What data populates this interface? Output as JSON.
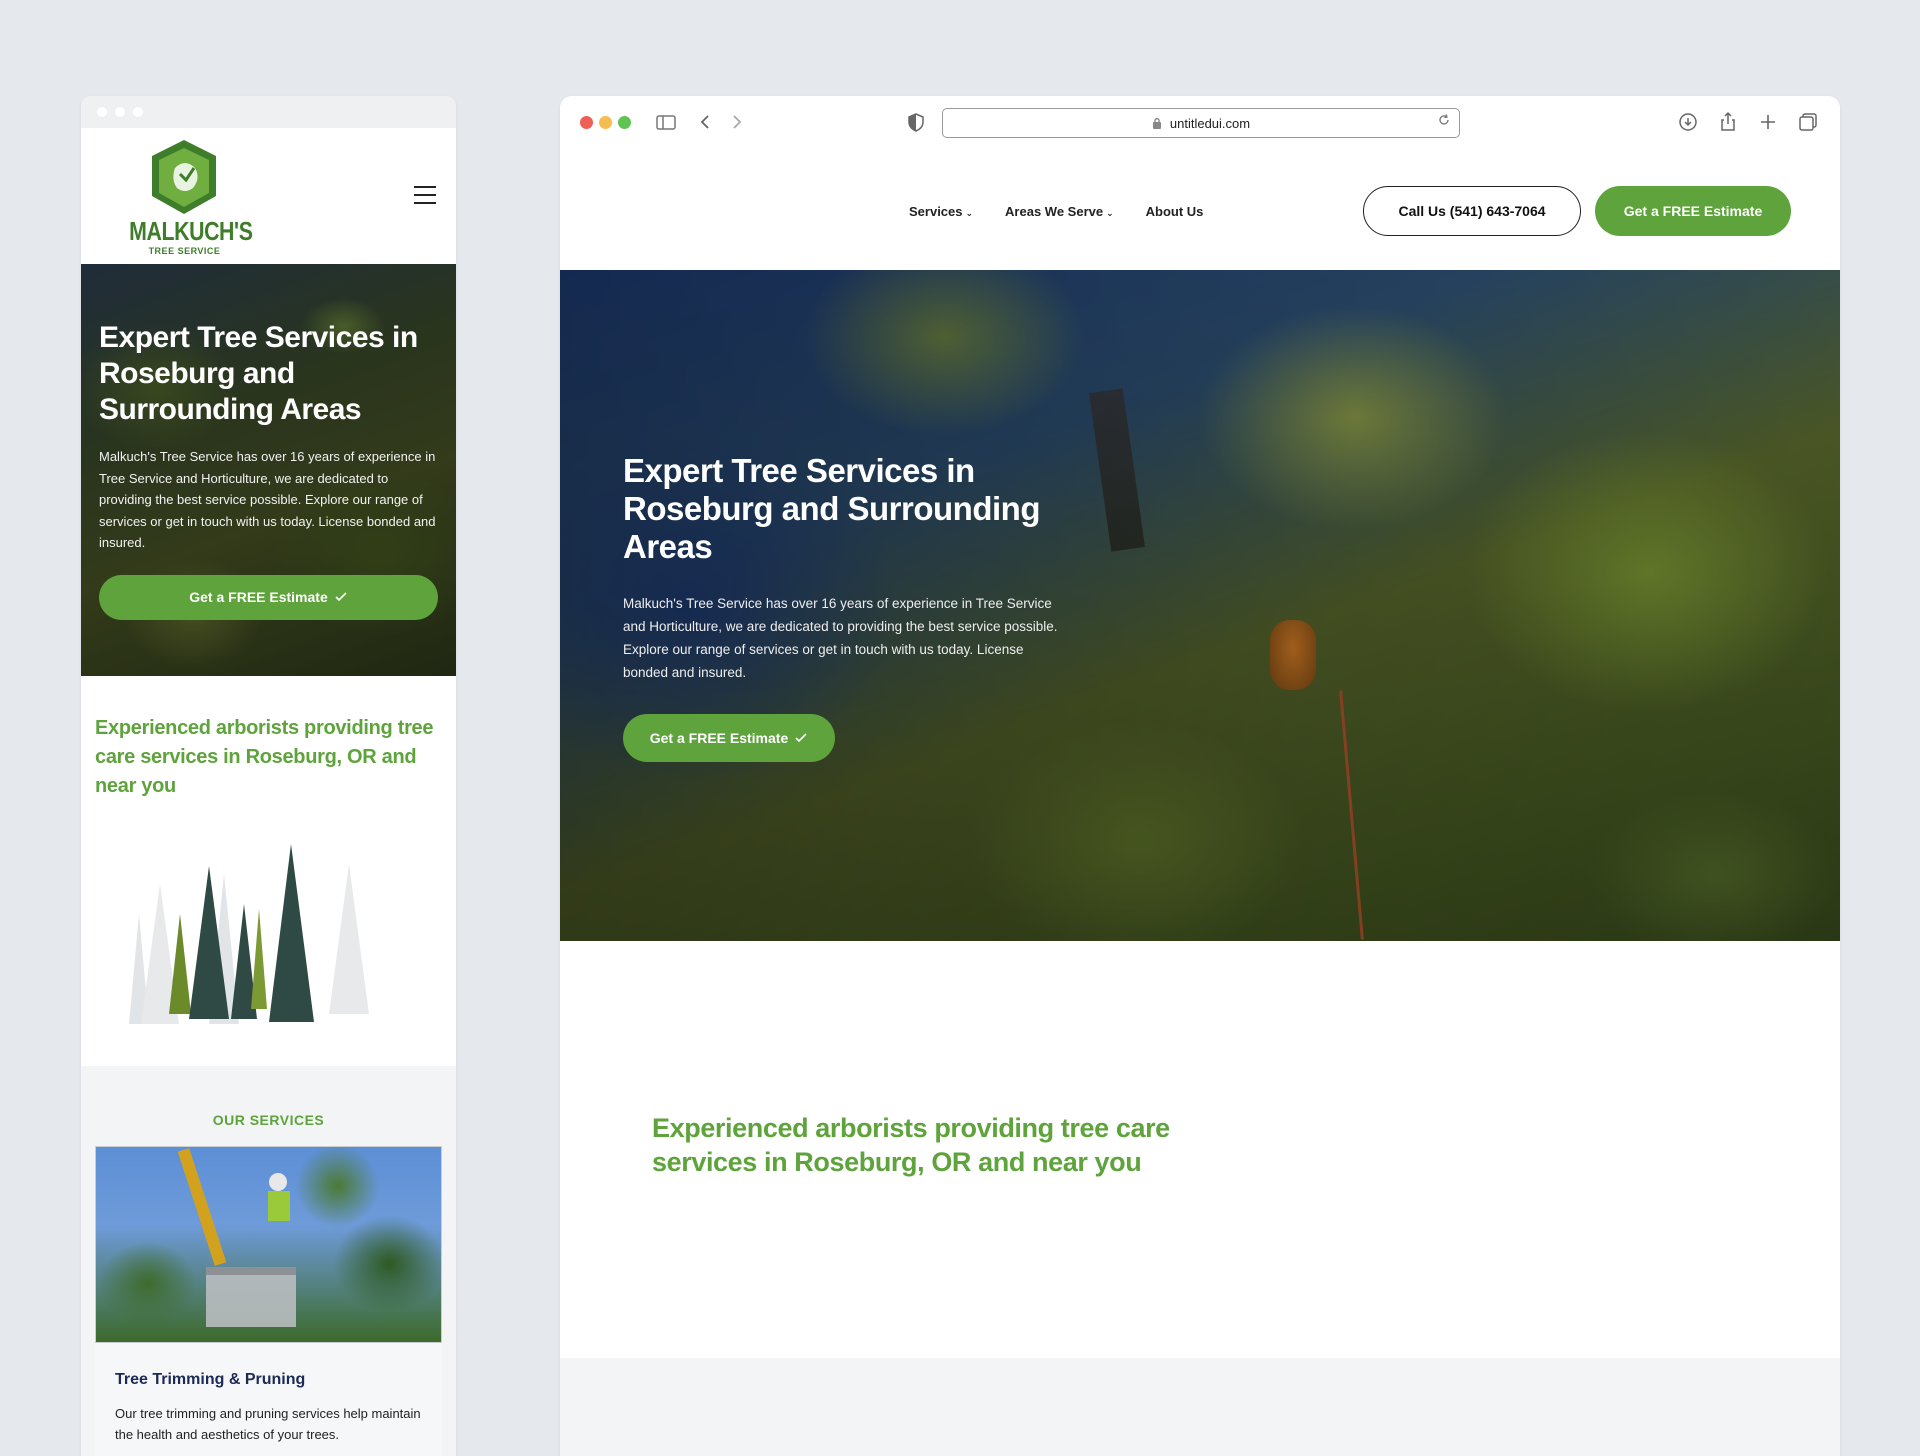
{
  "mobile": {
    "logo": {
      "name": "MALKUCH'S",
      "tagline": "TREE SERVICE"
    },
    "hero": {
      "title": "Expert Tree Services in Roseburg and Surrounding Areas",
      "body": "Malkuch's Tree Service has over 16 years of experience in Tree Service and Horticulture, we are dedicated to providing the best service possible. Explore our range of services or get in touch with us today. License bonded and insured.",
      "cta": "Get a FREE Estimate"
    },
    "intro": {
      "headline": "Experienced arborists providing tree care services in Roseburg, OR and near you"
    },
    "services": {
      "eyebrow": "OUR SERVICES",
      "card": {
        "title": "Tree Trimming & Pruning",
        "body": "Our tree trimming and pruning services help maintain the health and aesthetics of your trees."
      }
    }
  },
  "desktop": {
    "browser": {
      "url": "untitledui.com"
    },
    "nav": {
      "items": [
        {
          "label": "Services",
          "has_dropdown": true
        },
        {
          "label": "Areas We Serve",
          "has_dropdown": true
        },
        {
          "label": "About Us",
          "has_dropdown": false
        }
      ],
      "call_button": "Call Us (541) 643-7064",
      "estimate_button": "Get a FREE Estimate"
    },
    "hero": {
      "title": "Expert Tree Services in Roseburg and Surrounding Areas",
      "body": "Malkuch's Tree Service has over 16 years of experience in Tree Service and Horticulture, we are dedicated to providing the best service possible. Explore our range of services or get in touch with us today. License bonded and insured.",
      "cta": "Get a FREE Estimate"
    },
    "intro": {
      "headline": "Experienced arborists providing tree care services in Roseburg, OR and near you"
    }
  },
  "icons": {
    "check": "check-icon",
    "chevron": "chevron-down-icon",
    "lock": "lock-icon",
    "reload": "reload-icon",
    "menu": "hamburger-menu-icon"
  },
  "colors": {
    "brand_green": "#5ea33b",
    "logo_green": "#3e7d2a",
    "card_title": "#1c2a55",
    "background": "#e5e8ec"
  }
}
